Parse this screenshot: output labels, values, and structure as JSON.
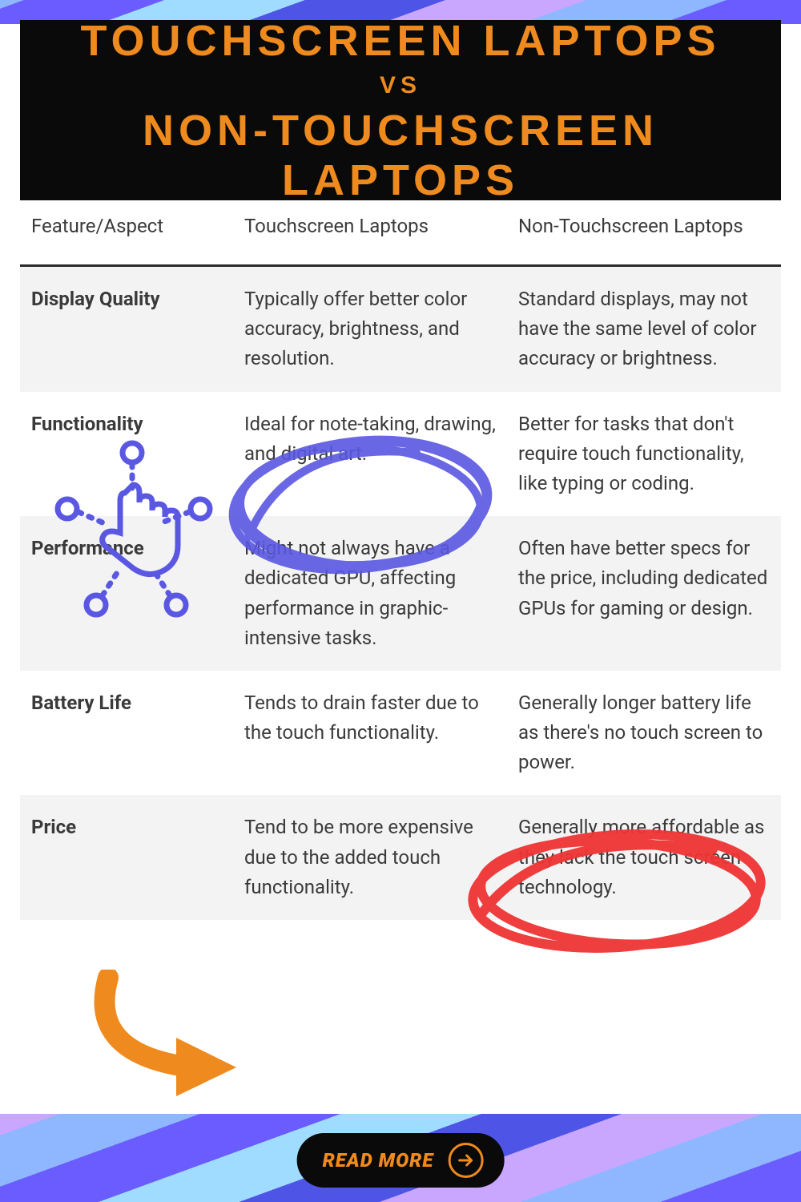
{
  "header": {
    "line1": "TOUCHSCREEN LAPTOPS",
    "vs": "VS",
    "line2": "NON-TOUCHSCREEN LAPTOPS"
  },
  "table": {
    "columns": [
      "Feature/Aspect",
      "Touchscreen Laptops",
      "Non-Touchscreen Laptops"
    ],
    "rows": [
      {
        "label": "Display Quality",
        "touch": "Typically offer better color accuracy, brightness, and resolution.",
        "non": "Standard displays, may not have the same level of color accuracy or brightness."
      },
      {
        "label": "Functionality",
        "touch": "Ideal for note-taking, drawing, and digital art.",
        "non": "Better for tasks that don't require touch functionality, like typing or coding."
      },
      {
        "label": "Performance",
        "touch": "Might not always have a dedicated GPU, affecting performance in graphic-intensive tasks.",
        "non": "Often have better specs for the price, including dedicated GPUs for gaming or design."
      },
      {
        "label": "Battery Life",
        "touch": "Tends to drain faster due to the touch functionality.",
        "non": "Generally longer battery life as there's no touch screen to power."
      },
      {
        "label": "Price",
        "touch": "Tend to be more expensive due to the added touch functionality.",
        "non": "Generally more affordable as they lack the touch screen technology."
      }
    ]
  },
  "cta": {
    "label": "READ MORE"
  },
  "colors": {
    "accent": "#ef8b1e",
    "purple_marker": "#5a57e2",
    "red_marker": "#ef3434",
    "orange_arrow": "#ef8b1e"
  }
}
